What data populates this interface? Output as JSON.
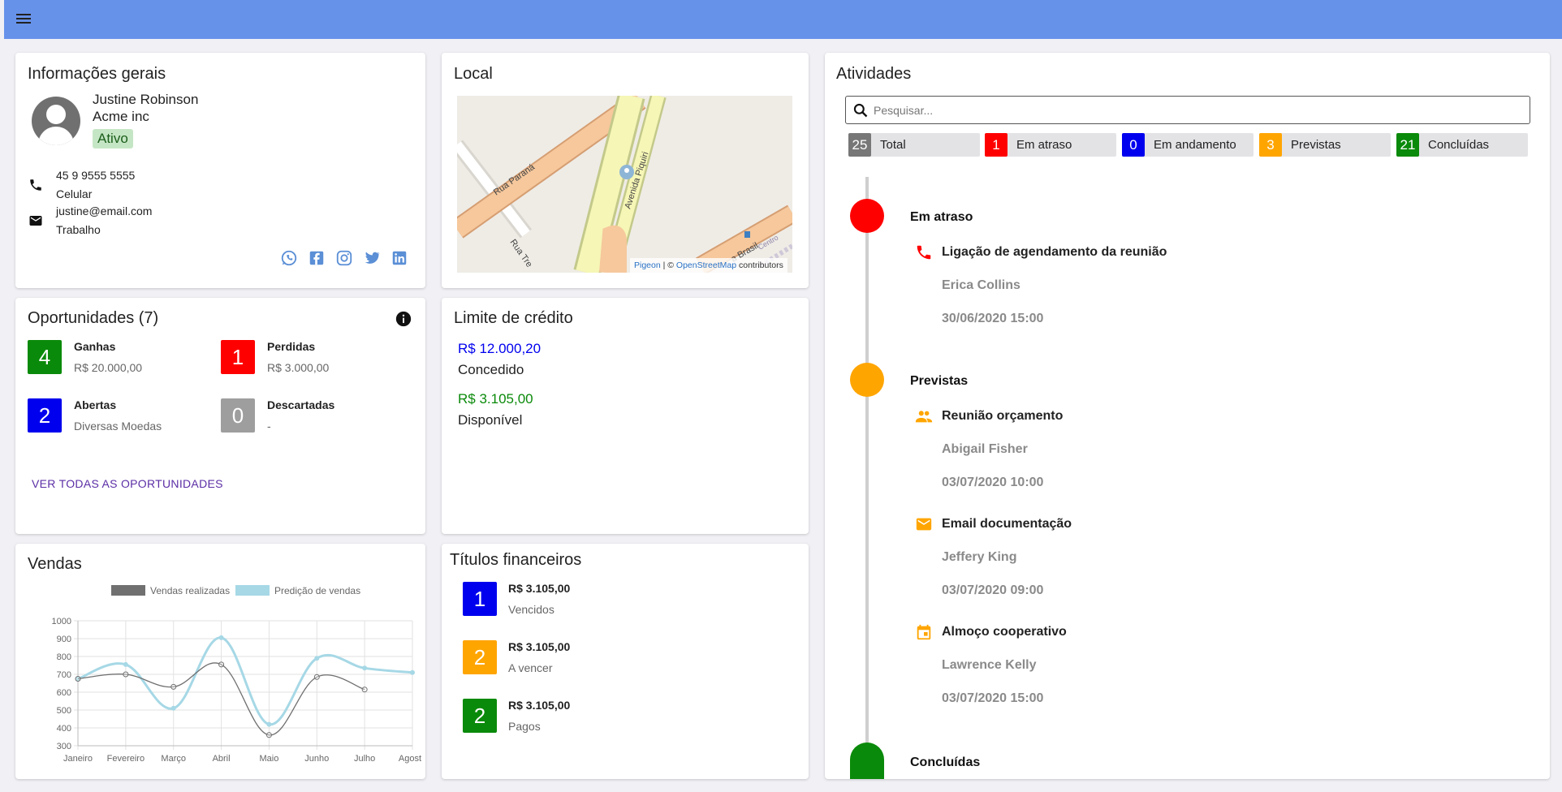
{
  "colors": {
    "topbar": "#6792ea",
    "green": "#0a8a0a",
    "red": "#ff0000",
    "blue": "#0000ee",
    "gray": "#9e9e9e",
    "orange": "#ffa500",
    "darkgray": "#777777"
  },
  "general": {
    "title": "Informações gerais",
    "name": "Justine Robinson",
    "company": "Acme inc",
    "status": "Ativo",
    "phone": "45 9 9555 5555",
    "phone_type": "Celular",
    "email": "justine@email.com",
    "email_type": "Trabalho",
    "social_icons": [
      "whatsapp-icon",
      "facebook-icon",
      "instagram-icon",
      "twitter-icon",
      "linkedin-icon"
    ]
  },
  "local": {
    "title": "Local",
    "streets": [
      "Rua Paraná",
      "Avenida Piquiri",
      "Rua Tre",
      "a Brasil",
      "Centro"
    ],
    "attribution_link1": "Pigeon",
    "attribution_sep": " | © ",
    "attribution_link2": "OpenStreetMap",
    "attribution_tail": " contributors"
  },
  "opportunities": {
    "title": "Oportunidades (7)",
    "items": [
      {
        "count": "4",
        "label": "Ganhas",
        "value": "R$ 20.000,00",
        "color": "#0a8a0a"
      },
      {
        "count": "1",
        "label": "Perdidas",
        "value": "R$ 3.000,00",
        "color": "#ff0000"
      },
      {
        "count": "2",
        "label": "Abertas",
        "value": "Diversas Moedas",
        "color": "#0000ee"
      },
      {
        "count": "0",
        "label": "Descartadas",
        "value": "-",
        "color": "#9e9e9e"
      }
    ],
    "see_all": "VER TODAS AS OPORTUNIDADES"
  },
  "credit": {
    "title": "Limite de crédito",
    "granted_value": "R$ 12.000,20",
    "granted_label": "Concedido",
    "available_value": "R$ 3.105,00",
    "available_label": "Disponível"
  },
  "sales": {
    "title": "Vendas"
  },
  "chart_data": {
    "type": "line",
    "title": "Vendas",
    "categories": [
      "Janeiro",
      "Fevereiro",
      "Março",
      "Abril",
      "Maio",
      "Junho",
      "Julho",
      "Agosto"
    ],
    "series": [
      {
        "name": "Vendas realizadas",
        "values": [
          675,
          700,
          630,
          755,
          360,
          685,
          615,
          null
        ],
        "color": "#707070"
      },
      {
        "name": "Predição de vendas",
        "values": [
          675,
          755,
          510,
          905,
          420,
          790,
          735,
          710
        ],
        "color": "#a6d8e6"
      }
    ],
    "ylim": [
      300,
      1000
    ],
    "yticks": [
      "1000",
      "900",
      "800",
      "700",
      "600",
      "500",
      "400",
      "300"
    ],
    "grid": true,
    "legend": "top"
  },
  "titles": {
    "title": "Títulos financeiros",
    "items": [
      {
        "count": "1",
        "value": "R$ 3.105,00",
        "label": "Vencidos",
        "color": "#0000ee"
      },
      {
        "count": "2",
        "value": "R$ 3.105,00",
        "label": "A vencer",
        "color": "#ffa500"
      },
      {
        "count": "2",
        "value": "R$ 3.105,00",
        "label": "Pagos",
        "color": "#0a8a0a"
      }
    ]
  },
  "activities": {
    "title": "Atividades",
    "search_placeholder": "Pesquisar...",
    "filters": [
      {
        "count": "25",
        "label": "Total",
        "color": "#777777"
      },
      {
        "count": "1",
        "label": "Em atraso",
        "color": "#ff0000"
      },
      {
        "count": "0",
        "label": "Em andamento",
        "color": "#0000ee"
      },
      {
        "count": "3",
        "label": "Previstas",
        "color": "#ffa500"
      },
      {
        "count": "21",
        "label": "Concluídas",
        "color": "#0a8a0a"
      }
    ],
    "groups": {
      "late": {
        "title": "Em atraso",
        "color": "#ff0000"
      },
      "planned": {
        "title": "Previstas",
        "color": "#ffa500"
      },
      "done": {
        "title": "Concluídas",
        "color": "#0a8a0a"
      }
    },
    "items": [
      {
        "icon": "phone-icon",
        "title": "Ligação de agendamento da reunião",
        "person": "Erica Collins",
        "date": "30/06/2020 15:00"
      },
      {
        "icon": "people-icon",
        "title": "Reunião orçamento",
        "person": "Abigail Fisher",
        "date": "03/07/2020 10:00"
      },
      {
        "icon": "email-icon",
        "title": "Email documentação",
        "person": "Jeffery King",
        "date": "03/07/2020 09:00"
      },
      {
        "icon": "calendar-icon",
        "title": "Almoço cooperativo",
        "person": "Lawrence Kelly",
        "date": "03/07/2020 15:00"
      }
    ]
  }
}
